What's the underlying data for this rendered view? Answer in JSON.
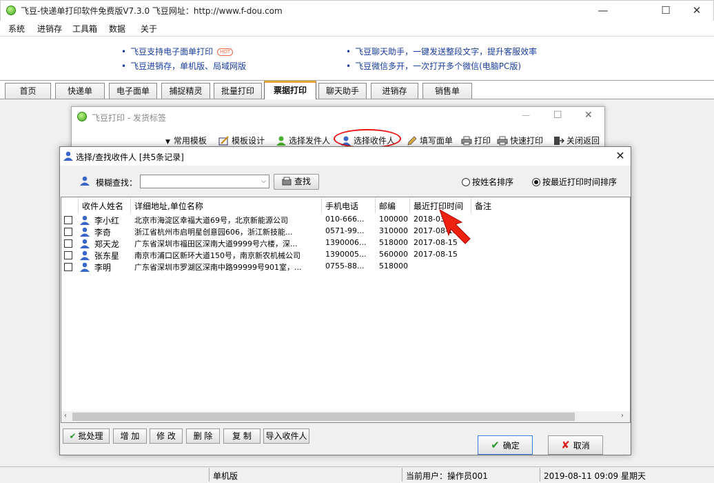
{
  "app": {
    "title": "飞豆-快递单打印软件免费版V7.3.0  飞豆网址：http://www.f-dou.com",
    "minimize": "—",
    "maximize": "☐",
    "close": "✕"
  },
  "menu": [
    "系统",
    "进销存",
    "工具箱",
    "数据",
    "关于"
  ],
  "banner": {
    "left": [
      "飞豆支持电子面单打印",
      "飞豆进销存，单机版、局域网版"
    ],
    "hot_badge": "HOT",
    "right": [
      "飞豆聊天助手，一键发送整段文字，提升客服效率",
      "飞豆微信多开，一次打开多个微信(电脑PC版)"
    ]
  },
  "tabs": [
    "首页",
    "快递单",
    "电子面单",
    "捕捉精灵",
    "批量打印",
    "票据打印",
    "聊天助手",
    "进销存",
    "销售单"
  ],
  "active_tab": "票据打印",
  "win2": {
    "title": "飞豆打印 - 发货标签",
    "toolbar": [
      "常用模板",
      "模板设计",
      "选择发件人",
      "选择收件人",
      "填写面单",
      "打印",
      "快速打印",
      "关闭返回"
    ]
  },
  "dialog": {
    "title": "选择/查找收件人  [共5条记录]",
    "search_label": "模糊查找：",
    "search_value": "",
    "search_button": "查找",
    "sort_by_name": "按姓名排序",
    "sort_by_recent": "按最近打印时间排序",
    "sort_selected": "recent",
    "columns": [
      "收件人姓名",
      "详细地址,单位名称",
      "手机电话",
      "邮编",
      "最近打印时间",
      "备注"
    ],
    "rows": [
      {
        "name": "李小红",
        "address": "北京市海淀区幸福大道69号，北京新能源公司",
        "phone": "010-666...",
        "zip": "100000",
        "time": "2018-03",
        "note": ""
      },
      {
        "name": "李奇",
        "address": "浙江省杭州市启明星创意园606，浙江新技能...",
        "phone": "0571-99...",
        "zip": "310000",
        "time": "2017-08-15",
        "note": ""
      },
      {
        "name": "郑天龙",
        "address": "广东省深圳市福田区深南大道9999号六楼，深...",
        "phone": "1390006...",
        "zip": "518000",
        "time": "2017-08-15",
        "note": ""
      },
      {
        "name": "张东星",
        "address": "南京市浦口区新环大道150号，南京新农机械公司",
        "phone": "1390005...",
        "zip": "560000",
        "time": "2017-08-15",
        "note": ""
      },
      {
        "name": "李明",
        "address": "广东省深圳市罗湖区深南中路99999号901室，...",
        "phone": "0755-88...",
        "zip": "518000",
        "time": "",
        "note": ""
      }
    ],
    "actions": [
      "批处理",
      "增 加",
      "修 改",
      "删 除",
      "复 制",
      "导入收件人"
    ],
    "ok": "确定",
    "cancel": "取消"
  },
  "status": {
    "mode": "单机版",
    "user": "当前用户：操作员001",
    "datetime": "2019-08-11 09:09 星期天"
  },
  "colors": {
    "accent_tab": "#e8a33a",
    "link": "#1a3d9e",
    "highlight": "#e11111"
  }
}
